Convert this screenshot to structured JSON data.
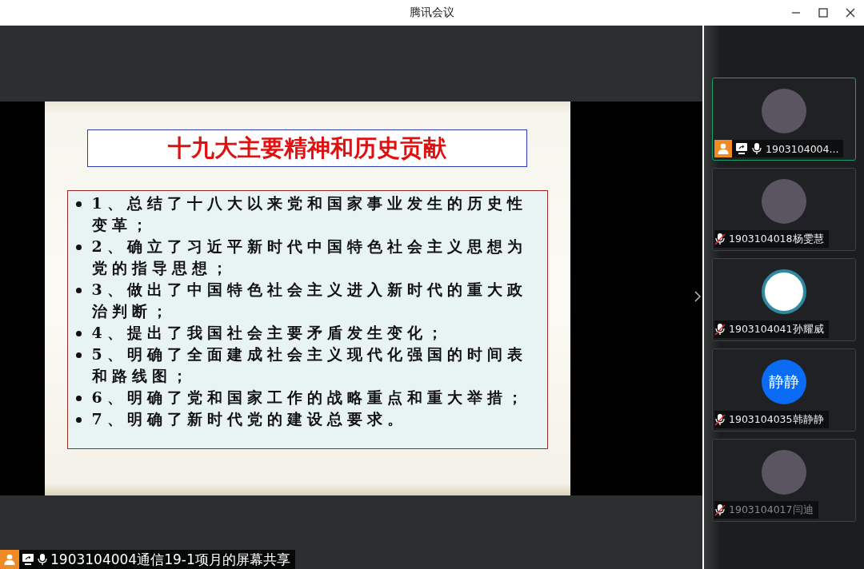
{
  "window": {
    "title": "腾讯会议"
  },
  "slide": {
    "title": "十九大主要精神和历史贡献",
    "bullets": [
      "1、总结了十八大以来党和国家事业发生的历史性变革；",
      "2、确立了习近平新时代中国特色社会主义思想为党的指导思想；",
      "3、做出了中国特色社会主义进入新时代的重大政治判断；",
      "4、提出了我国社会主要矛盾发生变化；",
      "5、明确了全面建成社会主义现代化强国的时间表和路线图；",
      "6、明确了党和国家工作的战略重点和重大举措；",
      "7、明确了新时代党的建设总要求。"
    ]
  },
  "share_label": {
    "text": "1903104004通信19-1项月的屏幕共享",
    "host": true,
    "sharing": true,
    "muted": false
  },
  "participants": [
    {
      "name": "1903104004...",
      "kind": "photo",
      "host": true,
      "sharing": true,
      "muted": false,
      "active": true,
      "dimmed": false
    },
    {
      "name": "1903104018杨雯慧",
      "kind": "photo",
      "host": false,
      "sharing": false,
      "muted": true,
      "active": false,
      "dimmed": false
    },
    {
      "name": "1903104041孙耀威",
      "kind": "logo",
      "host": false,
      "sharing": false,
      "muted": true,
      "active": false,
      "dimmed": false
    },
    {
      "name": "1903104035韩静静",
      "kind": "initials",
      "initials": "静静",
      "host": false,
      "sharing": false,
      "muted": true,
      "active": false,
      "dimmed": false
    },
    {
      "name": "1903104017闫迪",
      "kind": "photo",
      "host": false,
      "sharing": false,
      "muted": true,
      "active": false,
      "dimmed": true
    }
  ]
}
